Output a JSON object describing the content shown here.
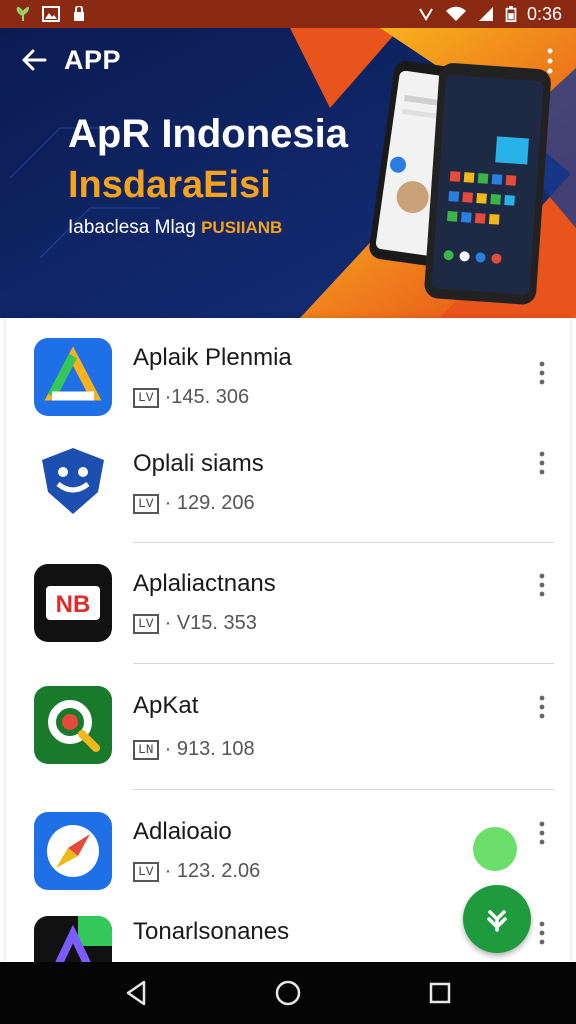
{
  "status_bar": {
    "time": "0:36",
    "icons": [
      "plant-icon",
      "gallery-icon",
      "lock-notification-icon",
      "vibrate-icon",
      "wifi-icon",
      "signal-icon",
      "battery-icon"
    ]
  },
  "app_bar": {
    "title": "APP",
    "back_icon": "arrow-left-icon",
    "more_icon": "more-vertical-icon"
  },
  "hero": {
    "title": "ApR Indonesia",
    "subtitle": "InsdaraEisi",
    "tagline": "Iabaclesa Mlag",
    "tagline_accent": "PUSIIANB",
    "colors": {
      "navy": "#0e1f5a",
      "orange": "#f4a31a",
      "deep_orange": "#e8541b"
    }
  },
  "apps": [
    {
      "name": "Aplaik Plenmia",
      "badge": "LV",
      "meta": "·145. 306",
      "icon": "triangle-logo-icon"
    },
    {
      "name": "Oplali siams",
      "badge": "LV",
      "meta": "· 129. 206",
      "icon": "shield-logo-icon"
    },
    {
      "name": "Aplaliactnans",
      "badge": "LV",
      "meta": "· V15. 353",
      "icon": "nb-logo-icon"
    },
    {
      "name": "ApKat",
      "badge": "LN",
      "meta": "· 913. 108",
      "icon": "magnifier-logo-icon"
    },
    {
      "name": "Adlaioaio",
      "badge": "LV",
      "meta": "· 123. 2.06",
      "icon": "compass-logo-icon"
    },
    {
      "name": "Tonarlsonanes",
      "badge": "",
      "meta": "",
      "icon": "prism-logo-icon"
    }
  ],
  "fab": {
    "icon": "download-icon",
    "color": "#1f9a3c"
  },
  "nav": {
    "back": "nav-back-icon",
    "home": "nav-home-icon",
    "recents": "nav-recents-icon"
  }
}
